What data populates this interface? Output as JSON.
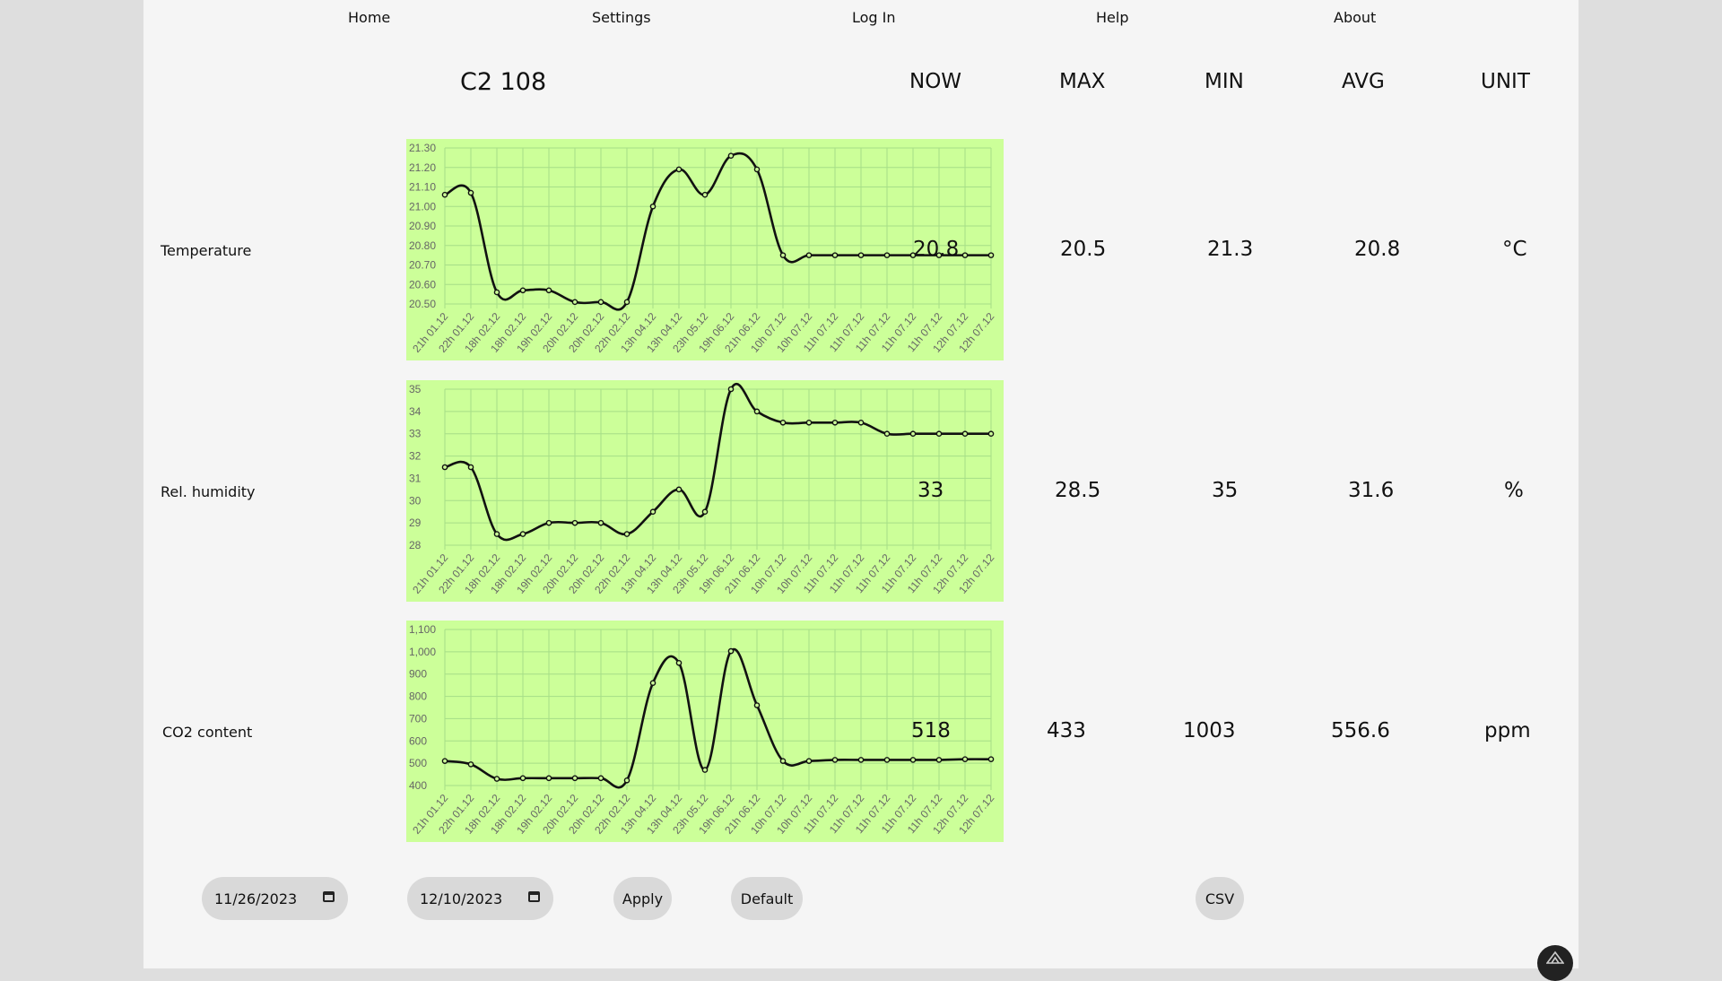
{
  "nav": [
    "Home",
    "Settings",
    "Log In",
    "Help",
    "About"
  ],
  "title": "C2 108",
  "columns": [
    "NOW",
    "MAX",
    "MIN",
    "AVG",
    "UNIT"
  ],
  "rows": [
    {
      "label": "Temperature",
      "values": [
        "20.8",
        "20.5",
        "21.3",
        "20.8",
        "°C"
      ]
    },
    {
      "label": "Rel. humidity",
      "values": [
        "33",
        "28.5",
        "35",
        "31.6",
        "%"
      ]
    },
    {
      "label": "CO2 content",
      "values": [
        "518",
        "433",
        "1003",
        "556.6",
        "ppm"
      ]
    }
  ],
  "controls": {
    "start_date": "11/26/2023",
    "end_date": "12/10/2023",
    "apply": "Apply",
    "default": "Default",
    "csv": "CSV"
  },
  "colors": {
    "chart_bg": "#ccff99",
    "grid": "#a6de88",
    "line": "#111111",
    "page": "#f5f5f5",
    "outer": "#dedede",
    "button": "#d9d9d9"
  },
  "chart_data": [
    {
      "type": "line",
      "categories": [
        "21h 01.12",
        "22h 01.12",
        "18h 02.12",
        "18h 02.12",
        "19h 02.12",
        "20h 02.12",
        "20h 02.12",
        "22h 02.12",
        "13h 04.12",
        "13h 04.12",
        "23h 05.12",
        "19h 06.12",
        "21h 06.12",
        "10h 07.12",
        "10h 07.12",
        "11h 07.12",
        "11h 07.12",
        "11h 07.12",
        "11h 07.12",
        "11h 07.12",
        "12h 07.12",
        "12h 07.12"
      ],
      "series": [
        {
          "values": [
            21.06,
            21.07,
            20.56,
            20.57,
            20.57,
            20.51,
            20.51,
            20.51,
            21.0,
            21.19,
            21.06,
            21.26,
            21.19,
            20.75,
            20.75,
            20.75,
            20.75,
            20.75,
            20.75,
            20.75,
            20.75,
            20.75
          ]
        }
      ],
      "yticks": [
        "21.30",
        "21.20",
        "21.10",
        "21.00",
        "20.90",
        "20.80",
        "20.70",
        "20.60",
        "20.50"
      ],
      "ylim": [
        20.5,
        21.3
      ]
    },
    {
      "type": "line",
      "categories": [
        "21h 01.12",
        "22h 01.12",
        "18h 02.12",
        "18h 02.12",
        "19h 02.12",
        "20h 02.12",
        "20h 02.12",
        "22h 02.12",
        "13h 04.12",
        "13h 04.12",
        "23h 05.12",
        "19h 06.12",
        "21h 06.12",
        "10h 07.12",
        "10h 07.12",
        "11h 07.12",
        "11h 07.12",
        "11h 07.12",
        "11h 07.12",
        "11h 07.12",
        "12h 07.12",
        "12h 07.12"
      ],
      "series": [
        {
          "values": [
            31.5,
            31.5,
            28.5,
            28.5,
            29,
            29,
            29,
            28.5,
            29.5,
            30.5,
            29.5,
            35,
            34,
            33.5,
            33.5,
            33.5,
            33.5,
            33,
            33,
            33,
            33,
            33
          ]
        }
      ],
      "yticks": [
        "35",
        "34",
        "33",
        "32",
        "31",
        "30",
        "29",
        "28"
      ],
      "ylim": [
        28,
        35
      ]
    },
    {
      "type": "line",
      "categories": [
        "21h 01.12",
        "22h 01.12",
        "18h 02.12",
        "18h 02.12",
        "19h 02.12",
        "20h 02.12",
        "20h 02.12",
        "22h 02.12",
        "13h 04.12",
        "13h 04.12",
        "23h 05.12",
        "19h 06.12",
        "21h 06.12",
        "10h 07.12",
        "10h 07.12",
        "11h 07.12",
        "11h 07.12",
        "11h 07.12",
        "11h 07.12",
        "11h 07.12",
        "12h 07.12",
        "12h 07.12"
      ],
      "series": [
        {
          "values": [
            510,
            495,
            430,
            433,
            433,
            433,
            433,
            423,
            860,
            950,
            470,
            1003,
            760,
            510,
            510,
            515,
            515,
            515,
            515,
            515,
            518,
            518
          ]
        }
      ],
      "yticks": [
        "1,100",
        "1,000",
        "900",
        "800",
        "700",
        "600",
        "500",
        "400"
      ],
      "ylim": [
        400,
        1100
      ]
    }
  ]
}
